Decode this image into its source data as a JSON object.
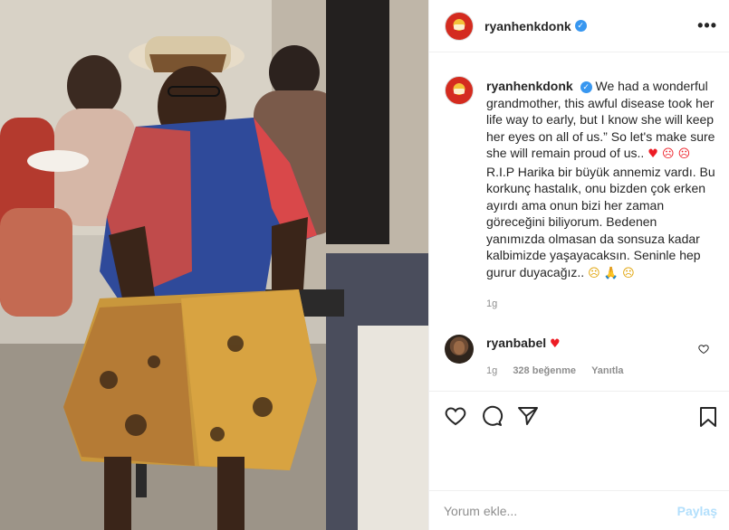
{
  "post": {
    "username": "ryanhenkdonk",
    "verified_mark": "✓",
    "more_label": "•••"
  },
  "caption": {
    "username": "ryanhenkdonk",
    "text_en": "We had a wonderful grandmother, this awful disease took her life way to early, but I know she will keep her eyes on all of us.” So let's make sure she will remain proud of us..",
    "emoji_a": "♥ ☹ ☹",
    "text_tr": "R.I.P Harika bir büyük annemiz vardı. Bu korkunç hastalık, onu bizden çok erken ayırdı ama onun bizi her zaman göreceğini biliyorum. Bedenen yanımızda olmasan da sonsuza kadar kalbimizde yaşayacaksın. Seninle hep gurur duyacağız..",
    "emoji_b": "☹ 🙏 ☹",
    "time": "1g"
  },
  "comment": {
    "username": "ryanbabel",
    "heart": "♥",
    "time": "1g",
    "likes": "328 beğenme",
    "reply": "Yanıtla"
  },
  "add_comment": {
    "placeholder": "Yorum ekle...",
    "post_label": "Paylaş"
  },
  "icons": [
    "heart-icon",
    "comment-icon",
    "share-icon",
    "bookmark-icon"
  ],
  "colors": {
    "accent": "#3897f0",
    "post_button": "#b2dffc",
    "muted": "#8e8e8e"
  }
}
